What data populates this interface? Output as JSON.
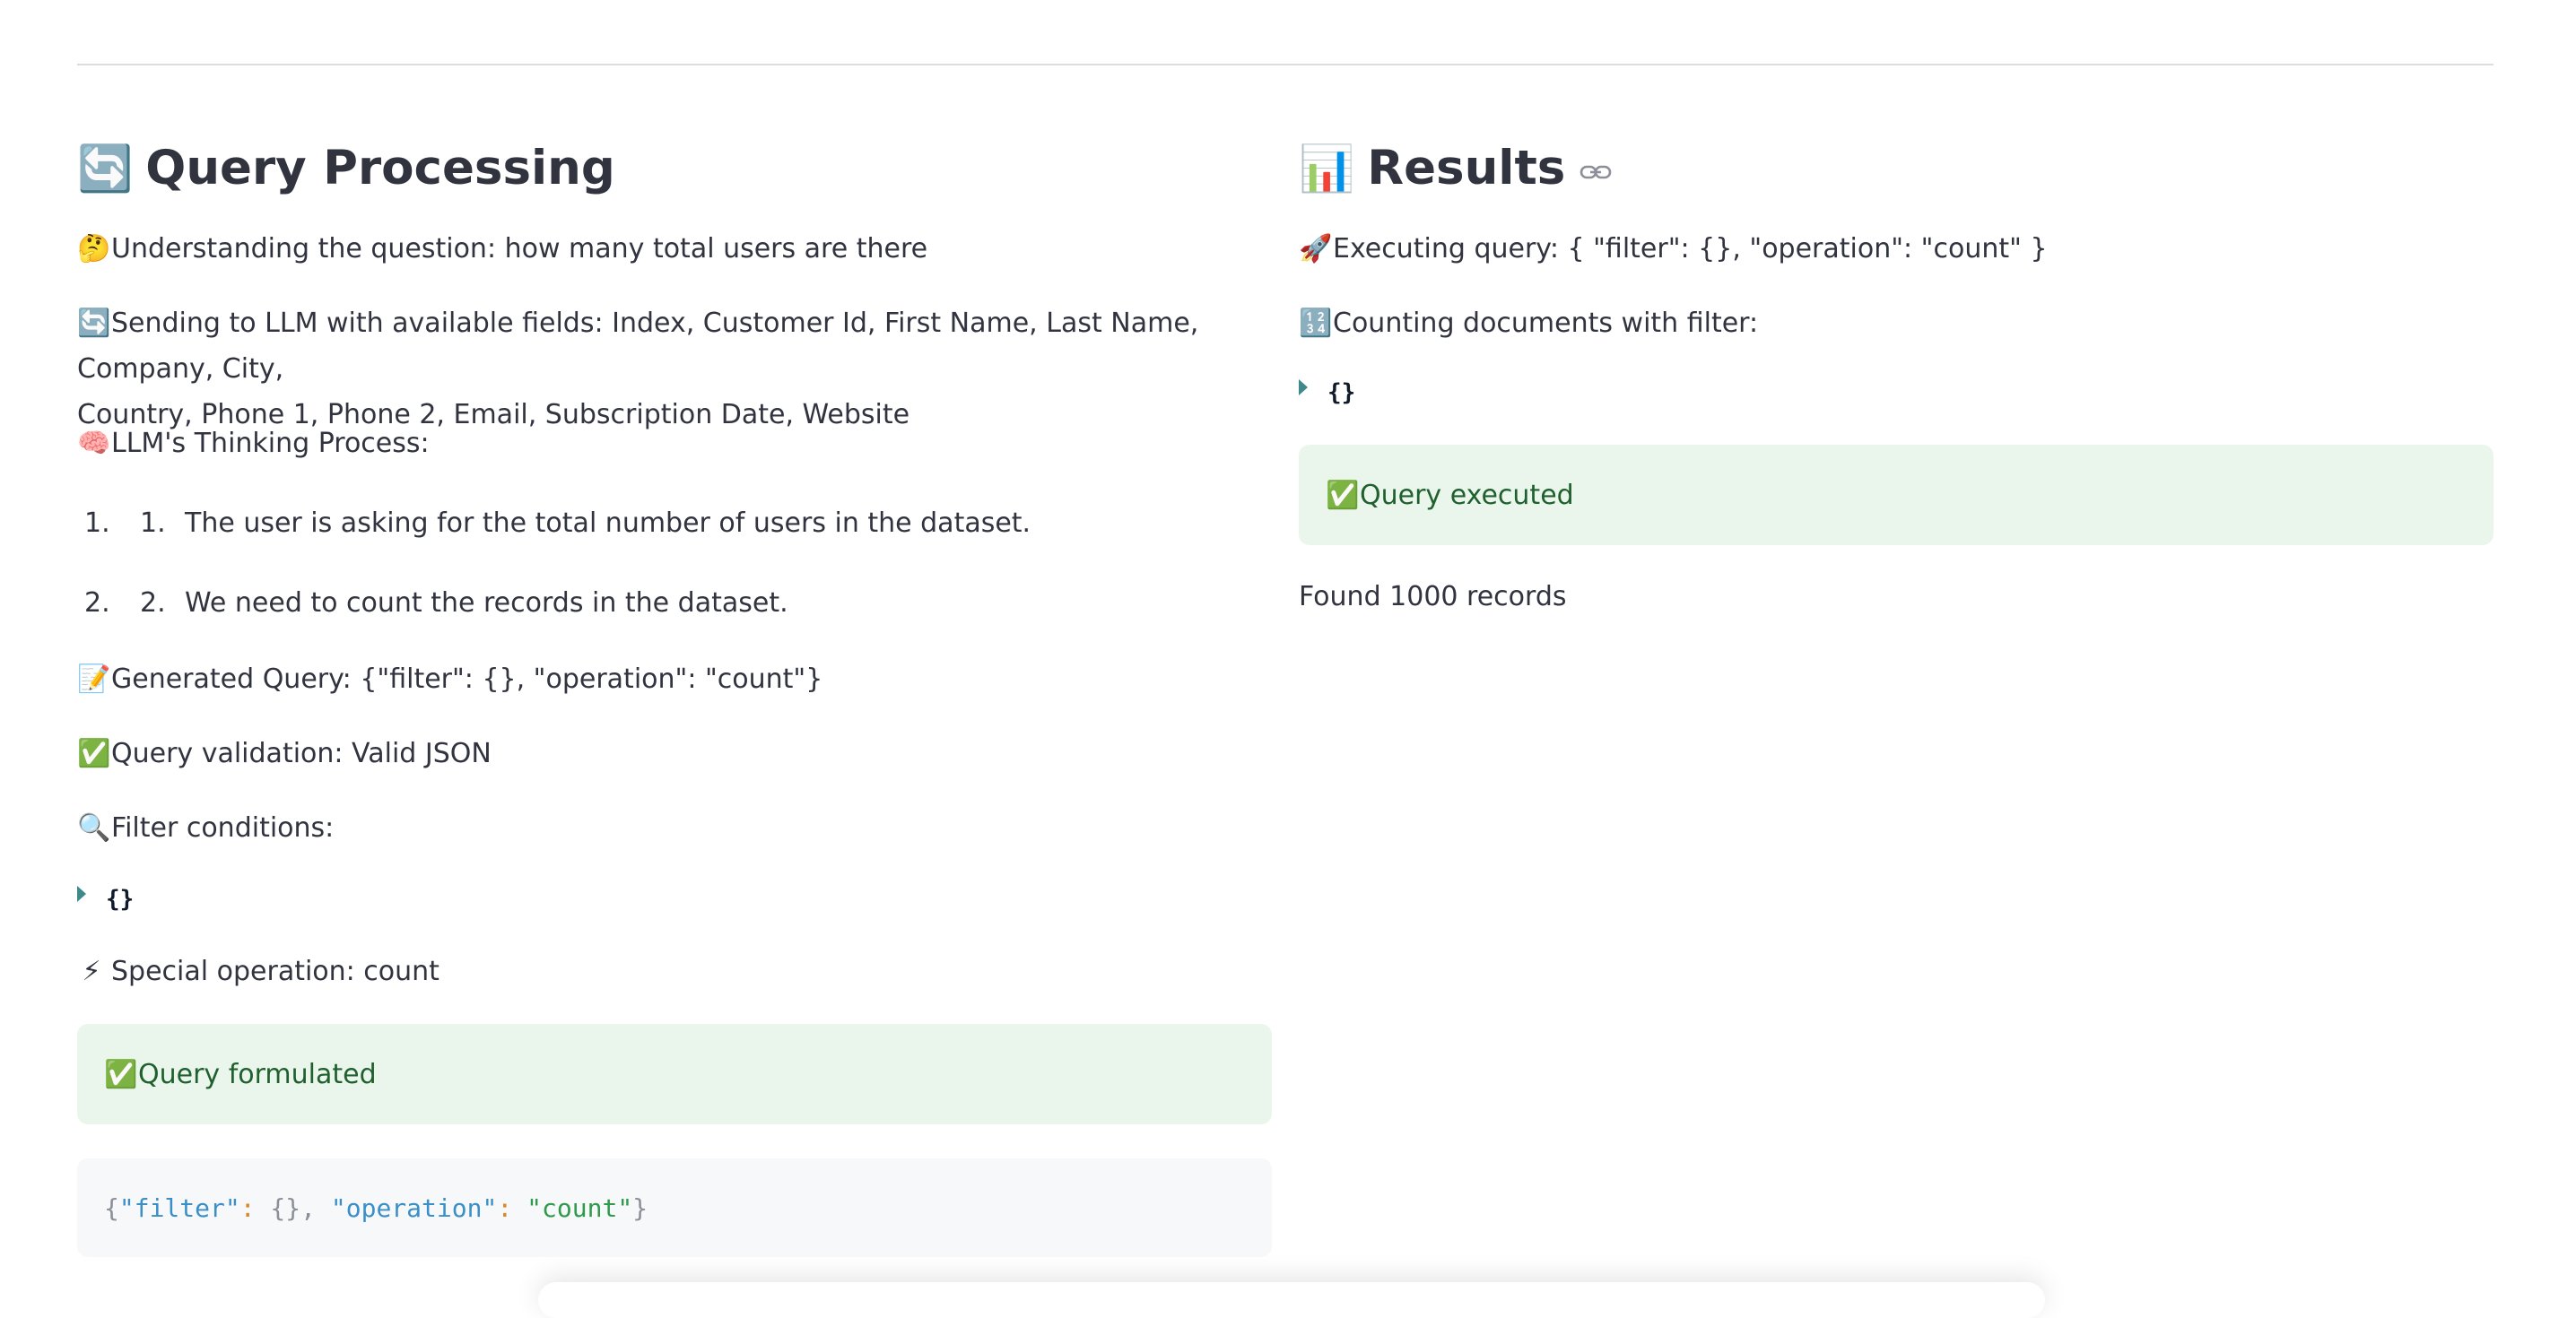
{
  "left": {
    "title_emoji": "🔄",
    "title": "Query Processing",
    "lines": [
      {
        "emoji": "🤔",
        "text": "Understanding the question: how many total users are there"
      },
      {
        "emoji": "🔄",
        "text_line1": "Sending to LLM with available fields: Index, Customer Id, First Name, Last Name, Company, City,",
        "text_line2": "Country, Phone 1, Phone 2, Email, Subscription Date, Website"
      },
      {
        "emoji": "🧠",
        "text": "LLM's Thinking Process:"
      }
    ],
    "thinking_steps": [
      {
        "outer": "1.",
        "inner": "1.",
        "text": "The user is asking for the total number of users in the dataset."
      },
      {
        "outer": "2.",
        "inner": "2.",
        "text": "We need to count the records in the dataset."
      }
    ],
    "generated_query": {
      "emoji": "📝",
      "text": "Generated Query: {\"filter\": {}, \"operation\": \"count\"}"
    },
    "validation": {
      "emoji": "✅",
      "text": "Query validation: Valid JSON"
    },
    "filter_conditions": {
      "emoji": "🔍",
      "text": "Filter conditions:"
    },
    "filter_json": "{}",
    "special_op": {
      "emoji": "⚡",
      "text": "Special operation: count"
    },
    "success_alert": {
      "emoji": "✅",
      "text": "Query formulated"
    },
    "code": {
      "open": "{",
      "key1": "\"filter\"",
      "colon1": ":",
      "val1": " {}, ",
      "key2": "\"operation\"",
      "colon2": ":",
      "val2": "\"count\"",
      "close": "}"
    }
  },
  "right": {
    "title_emoji": "📊",
    "title": "Results",
    "executing": {
      "emoji": "🚀",
      "text": "Executing query: { \"filter\": {}, \"operation\": \"count\" }"
    },
    "counting": {
      "emoji": "🔢",
      "text": "Counting documents with filter:"
    },
    "filter_json": "{}",
    "success_alert": {
      "emoji": "✅",
      "text": "Query executed"
    },
    "found": "Found 1000 records"
  }
}
